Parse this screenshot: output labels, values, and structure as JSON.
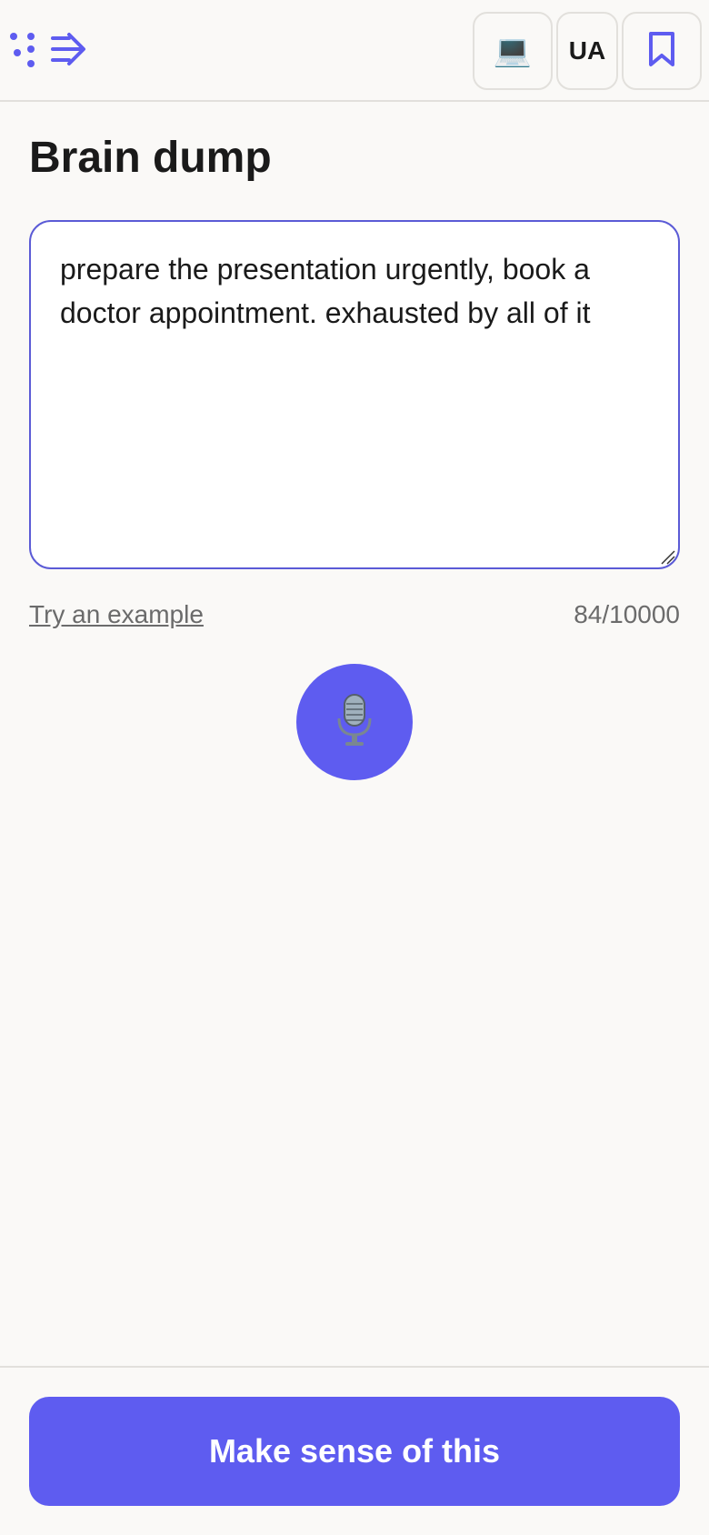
{
  "header": {
    "device_icon": "laptop-icon",
    "device_glyph": "💻",
    "language": "UA",
    "bookmark_icon": "bookmark-icon"
  },
  "main": {
    "title": "Brain dump",
    "dump_text": "prepare the presentation urgently, book a doctor appointment. exhausted by all of it",
    "example_link": "Try an example",
    "char_count": "84/10000",
    "mic_icon": "microphone-icon"
  },
  "footer": {
    "primary_label": "Make sense of this"
  },
  "colors": {
    "accent": "#5e5cf0",
    "background": "#faf9f7",
    "border": "#e2e0dc",
    "text": "#1a1a1a",
    "muted": "#6b6b6b"
  }
}
